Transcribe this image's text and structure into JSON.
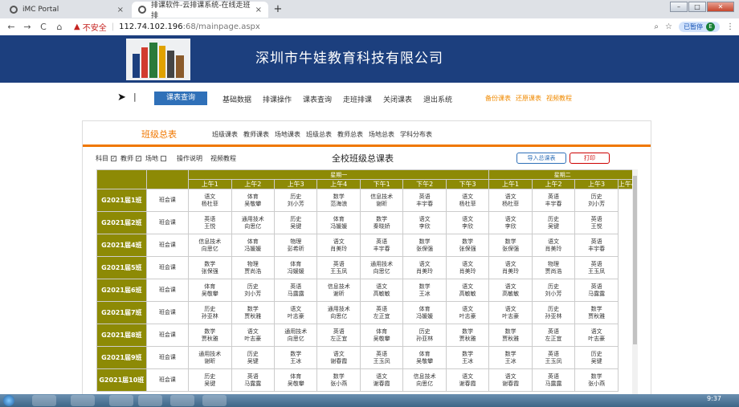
{
  "browser": {
    "tabs": [
      {
        "title": "iMC Portal",
        "close": "×"
      },
      {
        "title": "排课软件-云排课系统-在线走班排",
        "close": "×"
      }
    ],
    "new_tab": "+",
    "window_buttons": {
      "minimize": "–",
      "maximize": "□",
      "close": "✕"
    },
    "nav": {
      "back": "←",
      "forward": "→",
      "reload": "C",
      "home": "⌂"
    },
    "security_label": "不安全",
    "url_host": "112.74.102.196",
    "url_path": ":68/mainpage.aspx",
    "zoom_icon": "search-icon",
    "star_icon": "star-icon",
    "paused_label": "已暂停",
    "profile_initial": "E",
    "menu_icon": "⋮"
  },
  "banner": {
    "company": "深圳市牛娃教育科技有限公司"
  },
  "menu": {
    "active": "课表查询",
    "items": [
      "基础数据",
      "排课操作",
      "课表查询",
      "走班排课",
      "关闭课表",
      "退出系统"
    ],
    "right_items": [
      "备份课表",
      "还原课表",
      "视频教程"
    ]
  },
  "panel": {
    "title": "班级总表",
    "sub_tabs": [
      "班级课表",
      "教师课表",
      "场地课表",
      "班级总表",
      "教师总表",
      "场地总表",
      "学科分布表"
    ],
    "filters": [
      {
        "label": "科目",
        "checked": true
      },
      {
        "label": "教师",
        "checked": true
      },
      {
        "label": "场地",
        "checked": false
      }
    ],
    "links": [
      "操作说明",
      "视频教程"
    ],
    "table_title": "全校班级总课表",
    "import_button": "导入总课表",
    "print_button": "打印"
  },
  "schedule": {
    "days": [
      "星期一",
      "星期二"
    ],
    "periods": [
      "上午1",
      "上午2",
      "上午3",
      "上午4",
      "下午1",
      "下午2",
      "下午3"
    ],
    "rows": [
      {
        "class": "G2021届1班",
        "cells": [
          "班会课",
          "语文\n杨杜菲",
          "体育\n吴敬攀",
          "历史\n刘小芳",
          "数学\n范海浪",
          "信息技术\n谢昕",
          "英语\n丰宇春",
          "语文\n杨杜菲",
          "语文\n杨杜菲",
          "英语\n丰宇春",
          "历史\n刘小芳"
        ]
      },
      {
        "class": "G2021届2班",
        "cells": [
          "班会课",
          "英语\n王悦",
          "通用技术\n向思亿",
          "历史\n吴键",
          "体育\n冯媛媛",
          "数学\n秦晓娇",
          "语文\n李欣",
          "语文\n李欣",
          "语文\n李欣",
          "历史\n吴键",
          "英语\n王悦"
        ]
      },
      {
        "class": "G2021届4班",
        "cells": [
          "班会课",
          "信息技术\n向思亿",
          "体育\n冯媛媛",
          "物理\n彭希昕",
          "语文\n肖美玲",
          "英语\n丰宇春",
          "数学\n张保强",
          "数学\n张保强",
          "数学\n张保强",
          "语文\n肖美玲",
          "英语\n丰宇春"
        ]
      },
      {
        "class": "G2021届5班",
        "cells": [
          "班会课",
          "数学\n张保强",
          "物理\n贾尚浩",
          "体育\n冯媛媛",
          "英语\n王玉凤",
          "通用技术\n向思亿",
          "语文\n肖美玲",
          "语文\n肖美玲",
          "语文\n肖美玲",
          "物理\n贾尚浩",
          "英语\n王玉凤"
        ]
      },
      {
        "class": "G2021届6班",
        "cells": [
          "班会课",
          "体育\n吴敬攀",
          "历史\n刘小芳",
          "英语\n马露露",
          "信息技术\n谢昕",
          "语文\n高敏敏",
          "数学\n王冰",
          "语文\n高敏敏",
          "语文\n高敏敏",
          "历史\n刘小芳",
          "英语\n马露露"
        ]
      },
      {
        "class": "G2021届7班",
        "cells": [
          "班会课",
          "历史\n孙亚林",
          "数学\n贾秋雅",
          "语文\n叶志豪",
          "通用技术\n向思亿",
          "英语\n左正宜",
          "体育\n冯媛媛",
          "语文\n叶志豪",
          "语文\n叶志豪",
          "历史\n孙亚林",
          "数学\n贾秋雅"
        ]
      },
      {
        "class": "G2021届8班",
        "cells": [
          "班会课",
          "数学\n贾秋雅",
          "语文\n叶志豪",
          "通用技术\n向思亿",
          "英语\n左正宜",
          "体育\n吴敬攀",
          "历史\n孙亚林",
          "数学\n贾秋雅",
          "数学\n贾秋雅",
          "英语\n左正宜",
          "语文\n叶志豪"
        ]
      },
      {
        "class": "G2021届9班",
        "cells": [
          "班会课",
          "通用技术\n谢昕",
          "历史\n吴键",
          "数学\n王冰",
          "语文\n谢春霞",
          "英语\n王玉凤",
          "体育\n吴敬攀",
          "数学\n王冰",
          "数学\n王冰",
          "英语\n王玉凤",
          "历史\n吴键"
        ]
      },
      {
        "class": "G2021届10班",
        "cells": [
          "班会课",
          "历史\n吴键",
          "英语\n马露露",
          "体育\n吴敬攀",
          "数学\n张小燕",
          "语文\n谢春霞",
          "信息技术\n向思亿",
          "语文\n谢春霞",
          "语文\n谢春霞",
          "英语\n马露露",
          "数学\n张小燕"
        ]
      }
    ]
  },
  "taskbar": {
    "time": "9:37"
  }
}
